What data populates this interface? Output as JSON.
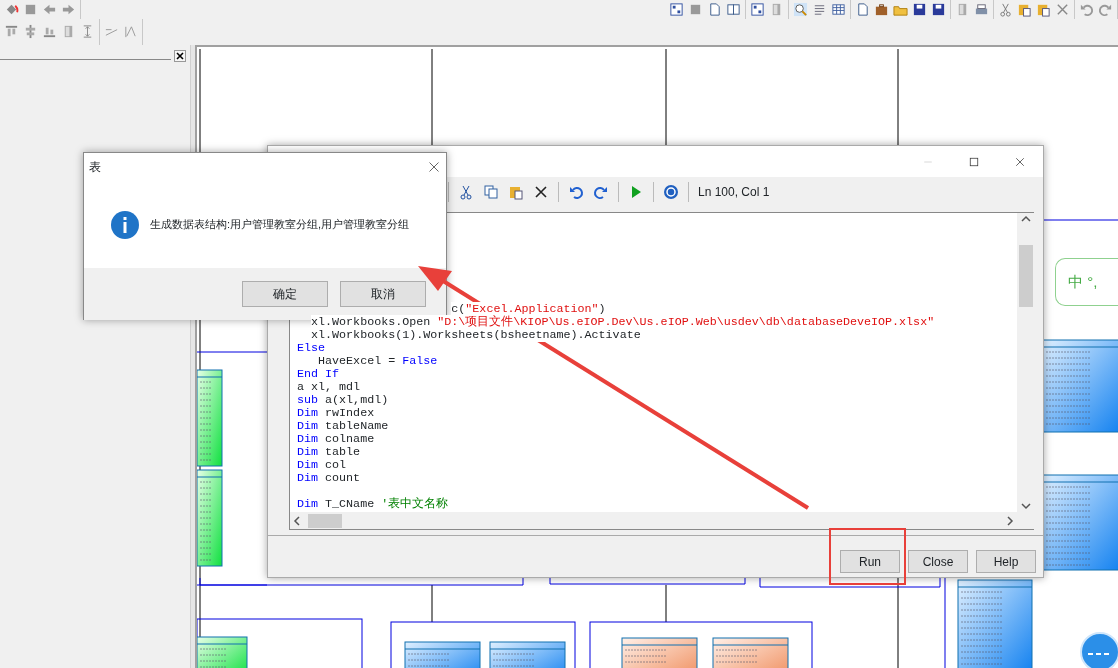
{
  "canvas": {
    "note": "中 °,"
  },
  "script_editor": {
    "status": "Ln 100, Col 1",
    "code_lines": [
      {
        "kind": "code",
        "segments": [
          {
            "kind": "plain",
            "text": "                      c("
          },
          {
            "kind": "string",
            "text": "\"Excel.Application\""
          },
          {
            "kind": "plain",
            "text": ")"
          }
        ]
      },
      {
        "kind": "code",
        "segments": [
          {
            "kind": "plain",
            "text": "  xl.Workbooks.Open "
          },
          {
            "kind": "string",
            "text": "\"D:\\项目文件\\KIOP\\Us.eIOP.Dev\\Us.eIOP.Web\\usdev\\db\\databaseDeveIOP.xlsx\""
          }
        ]
      },
      {
        "kind": "code",
        "segments": [
          {
            "kind": "plain",
            "text": "  xl.Workbooks(1).Worksheets(bsheetname).Activate"
          }
        ]
      },
      {
        "kind": "code",
        "segments": [
          {
            "kind": "keyword",
            "text": "Else"
          }
        ]
      },
      {
        "kind": "code",
        "segments": [
          {
            "kind": "plain",
            "text": "   HaveExcel = "
          },
          {
            "kind": "keyword",
            "text": "False"
          }
        ]
      },
      {
        "kind": "code",
        "segments": [
          {
            "kind": "keyword",
            "text": "End If"
          }
        ]
      },
      {
        "kind": "code",
        "segments": [
          {
            "kind": "plain",
            "text": "a xl, mdl"
          }
        ]
      },
      {
        "kind": "code",
        "segments": [
          {
            "kind": "keyword",
            "text": "sub"
          },
          {
            "kind": "plain",
            "text": " a(xl,mdl)"
          }
        ]
      },
      {
        "kind": "code",
        "segments": [
          {
            "kind": "keyword",
            "text": "Dim"
          },
          {
            "kind": "plain",
            "text": " rwIndex"
          }
        ]
      },
      {
        "kind": "code",
        "segments": [
          {
            "kind": "keyword",
            "text": "Dim"
          },
          {
            "kind": "plain",
            "text": " tableName"
          }
        ]
      },
      {
        "kind": "code",
        "segments": [
          {
            "kind": "keyword",
            "text": "Dim"
          },
          {
            "kind": "plain",
            "text": " colname"
          }
        ]
      },
      {
        "kind": "code",
        "segments": [
          {
            "kind": "keyword",
            "text": "Dim"
          },
          {
            "kind": "plain",
            "text": " table"
          }
        ]
      },
      {
        "kind": "code",
        "segments": [
          {
            "kind": "keyword",
            "text": "Dim"
          },
          {
            "kind": "plain",
            "text": " col"
          }
        ]
      },
      {
        "kind": "code",
        "segments": [
          {
            "kind": "keyword",
            "text": "Dim"
          },
          {
            "kind": "plain",
            "text": " count"
          }
        ]
      },
      {
        "kind": "blank"
      },
      {
        "kind": "code",
        "segments": [
          {
            "kind": "keyword",
            "text": "Dim"
          },
          {
            "kind": "plain",
            "text": " T_CName "
          },
          {
            "kind": "comment",
            "text": "'表中文名称"
          }
        ]
      }
    ],
    "buttons": [
      {
        "label": "Run",
        "highlighted": true
      },
      {
        "label": "Close",
        "highlighted": false
      },
      {
        "label": "Help",
        "highlighted": false
      }
    ]
  },
  "message_box": {
    "title": "表",
    "message": "生成数据表结构:用户管理教室分组,用户管理教室分组",
    "buttons": [
      "确定",
      "取消"
    ]
  }
}
